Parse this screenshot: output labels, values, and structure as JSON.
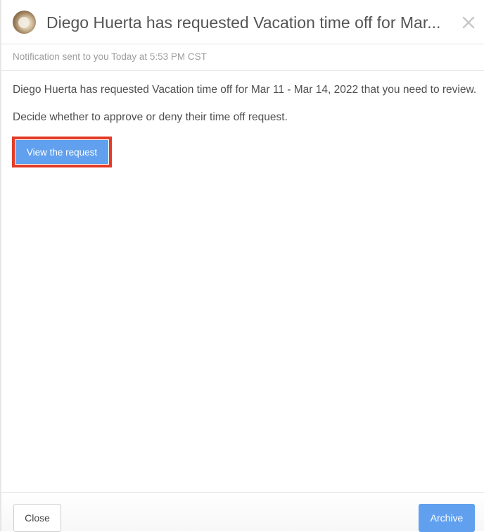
{
  "header": {
    "title": "Diego Huerta has requested Vacation time off for Mar...",
    "avatar_icon": "user-avatar",
    "close_icon": "close-icon"
  },
  "subheader": {
    "meta": "Notification sent to you Today at 5:53 PM CST"
  },
  "body": {
    "paragraph1": "Diego Huerta has requested Vacation time off for Mar 11 - Mar 14, 2022 that you need to review.",
    "paragraph2": "Decide whether to approve or deny their time off request.",
    "view_button": "View the request"
  },
  "footer": {
    "close_label": "Close",
    "archive_label": "Archive"
  },
  "colors": {
    "accent": "#61a0ee",
    "highlight": "#e33b27"
  }
}
